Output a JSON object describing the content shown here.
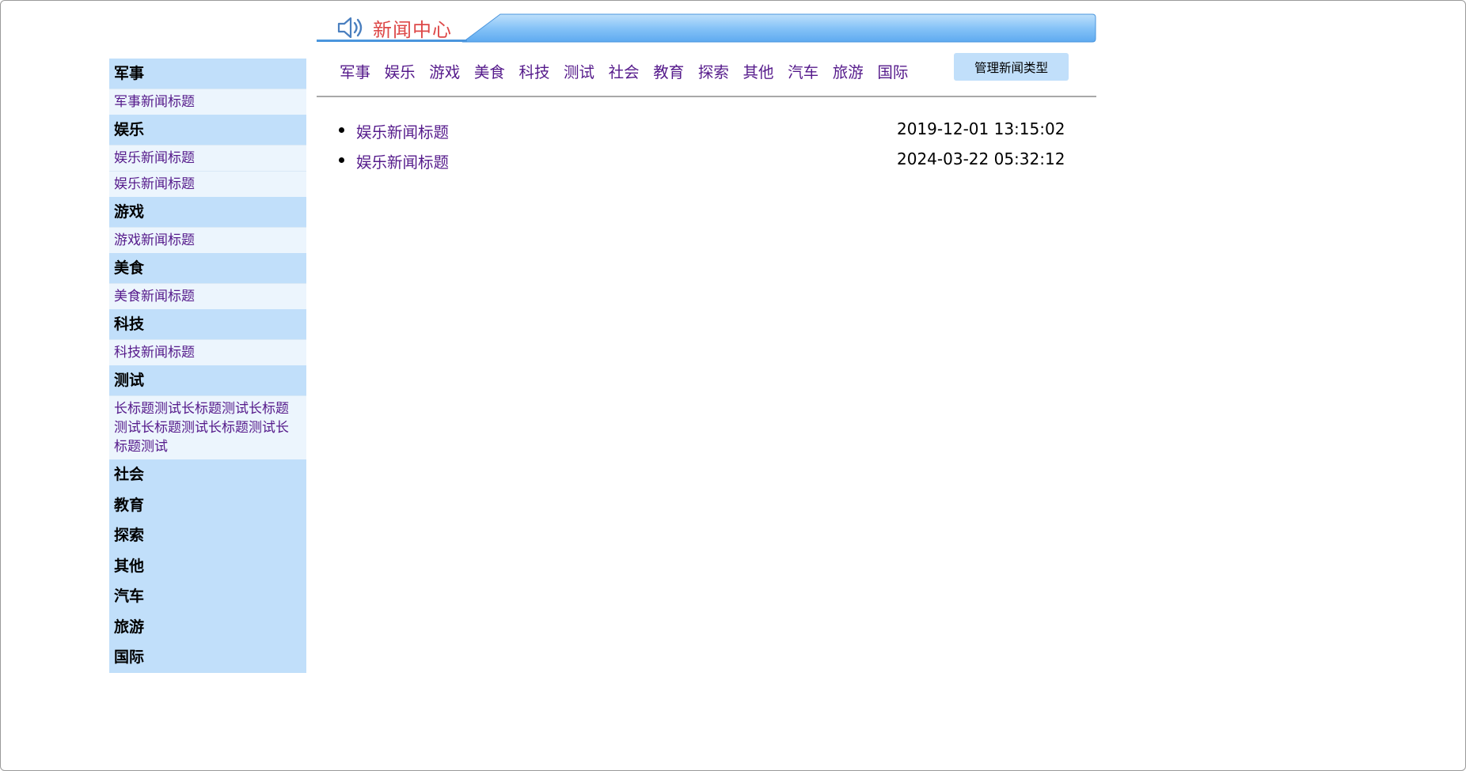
{
  "header": {
    "title": "新闻中心",
    "logo_icon": "speaker-icon"
  },
  "sidebar": {
    "categories": [
      {
        "name": "军事",
        "items": [
          "军事新闻标题"
        ]
      },
      {
        "name": "娱乐",
        "items": [
          "娱乐新闻标题",
          "娱乐新闻标题"
        ]
      },
      {
        "name": "游戏",
        "items": [
          "游戏新闻标题"
        ]
      },
      {
        "name": "美食",
        "items": [
          "美食新闻标题"
        ]
      },
      {
        "name": "科技",
        "items": [
          "科技新闻标题"
        ]
      },
      {
        "name": "测试",
        "items": [
          "长标题测试长标题测试长标题测试长标题测试长标题测试长标题测试"
        ]
      },
      {
        "name": "社会",
        "items": []
      },
      {
        "name": "教育",
        "items": []
      },
      {
        "name": "探索",
        "items": []
      },
      {
        "name": "其他",
        "items": []
      },
      {
        "name": "汽车",
        "items": []
      },
      {
        "name": "旅游",
        "items": []
      },
      {
        "name": "国际",
        "items": []
      }
    ]
  },
  "nav": {
    "links": [
      "军事",
      "娱乐",
      "游戏",
      "美食",
      "科技",
      "测试",
      "社会",
      "教育",
      "探索",
      "其他",
      "汽车",
      "旅游",
      "国际"
    ],
    "manage_label": "管理新闻类型"
  },
  "news": [
    {
      "title": "娱乐新闻标题",
      "time": "2019-12-01 13:15:02"
    },
    {
      "title": "娱乐新闻标题",
      "time": "2024-03-22 05:32:12"
    }
  ],
  "colors": {
    "sidebar_bg": "#c1dffa",
    "item_bg": "#ecf5fd",
    "link": "#551a8b",
    "title_red": "#dd4848",
    "banner_blue": "#66b1f5"
  }
}
